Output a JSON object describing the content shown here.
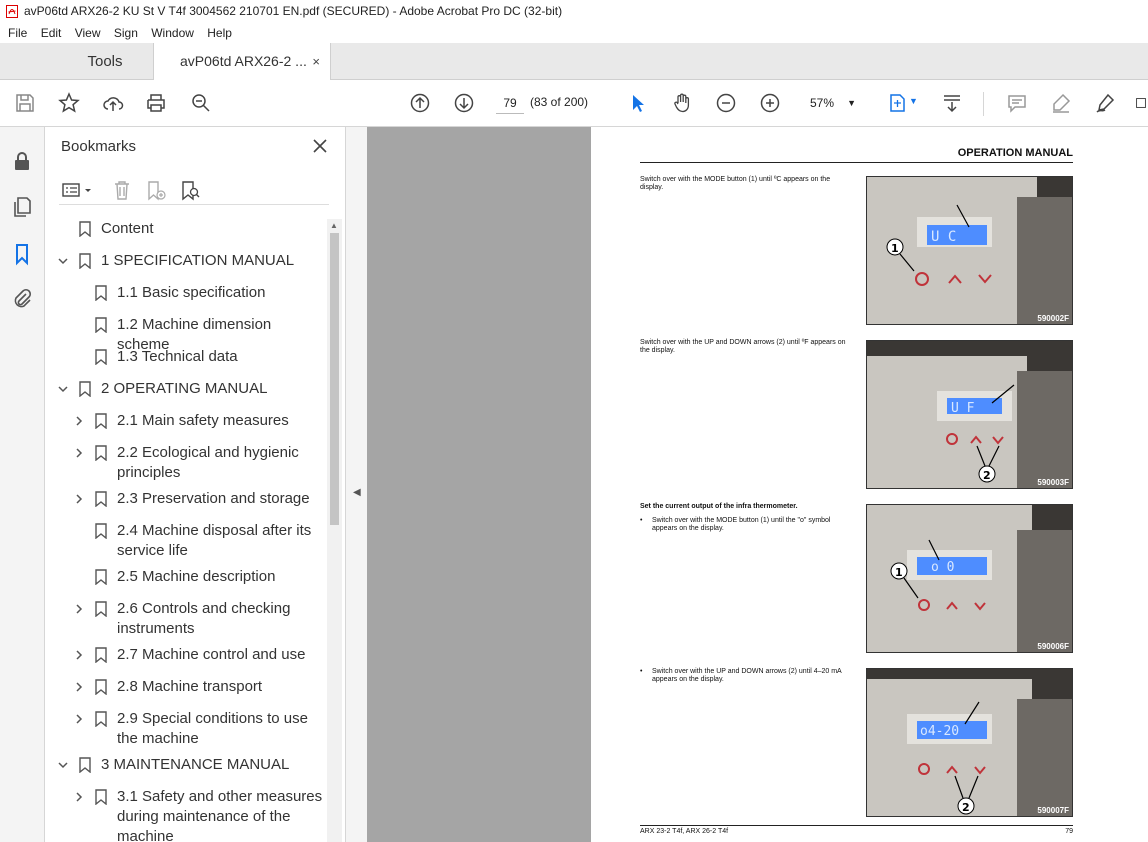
{
  "window": {
    "title": "avP06td ARX26-2 KU St V T4f 3004562 210701 EN.pdf (SECURED) - Adobe Acrobat Pro DC (32-bit)"
  },
  "menu": [
    "File",
    "Edit",
    "View",
    "Sign",
    "Window",
    "Help"
  ],
  "tabs": {
    "tools": "Tools",
    "document": "avP06td ARX26-2 ...",
    "close": "×"
  },
  "toolbar": {
    "page_value": "79",
    "page_count": "(83 of 200)",
    "zoom": "57%",
    "icons": [
      "save-icon",
      "star-icon",
      "upload-icon",
      "print-icon",
      "find-icon",
      "page-up-icon",
      "page-down-icon",
      "select-arrow-icon",
      "hand-icon",
      "zoom-out-icon",
      "zoom-in-icon",
      "fit-page-icon",
      "scroll-mode-icon",
      "comment-icon",
      "highlight-icon",
      "sign-icon"
    ]
  },
  "left_rail": {
    "icons": [
      "lock-icon",
      "pages-icon",
      "bookmark-icon",
      "attachment-icon"
    ]
  },
  "bookmarks": {
    "title": "Bookmarks",
    "items": [
      {
        "label": "Content",
        "level": 0,
        "expander": "none"
      },
      {
        "label": "1 SPECIFICATION MANUAL",
        "level": 0,
        "expander": "expanded"
      },
      {
        "label": "1.1 Basic specification",
        "level": 1,
        "expander": "none"
      },
      {
        "label": "1.2 Machine dimension scheme",
        "level": 1,
        "expander": "none"
      },
      {
        "label": "1.3 Technical data",
        "level": 1,
        "expander": "none"
      },
      {
        "label": "2 OPERATING MANUAL",
        "level": 0,
        "expander": "expanded"
      },
      {
        "label": "2.1 Main safety measures",
        "level": 1,
        "expander": "collapsed"
      },
      {
        "label": "2.2 Ecological and hygienic principles",
        "level": 1,
        "expander": "collapsed"
      },
      {
        "label": "2.3 Preservation and storage",
        "level": 1,
        "expander": "collapsed"
      },
      {
        "label": "2.4 Machine disposal after its service life",
        "level": 1,
        "expander": "none"
      },
      {
        "label": "2.5 Machine description",
        "level": 1,
        "expander": "none"
      },
      {
        "label": "2.6 Controls and checking instruments",
        "level": 1,
        "expander": "collapsed"
      },
      {
        "label": "2.7 Machine control and use",
        "level": 1,
        "expander": "collapsed"
      },
      {
        "label": "2.8 Machine transport",
        "level": 1,
        "expander": "collapsed"
      },
      {
        "label": "2.9 Special conditions to use the machine",
        "level": 1,
        "expander": "collapsed"
      },
      {
        "label": "3 MAINTENANCE MANUAL",
        "level": 0,
        "expander": "expanded"
      },
      {
        "label": "3.1 Safety and other measures during maintenance of the machine",
        "level": 1,
        "expander": "collapsed"
      }
    ]
  },
  "document_page": {
    "header": "OPERATION MANUAL",
    "blocks": [
      {
        "text": "Switch over with the MODE button (1) until ºC appears on the display.",
        "photo_code": "590002F",
        "callout": "1",
        "display": "U  C"
      },
      {
        "text": "Switch over with the UP and DOWN arrows (2) until ºF appears on the display.",
        "photo_code": "590003F",
        "callout": "2",
        "display": "U  F"
      },
      {
        "heading": "Set the current output of the infra thermometer.",
        "bullet": "•",
        "text": "Switch over with the MODE button (1) until the \"o\" symbol appears on the display.",
        "photo_code": "590006F",
        "callout": "1",
        "display": "o  0"
      },
      {
        "bullet": "•",
        "text": "Switch over with the UP and DOWN arrows (2) until 4–20 mA appears on the display.",
        "photo_code": "590007F",
        "callout": "2",
        "display": "o4-20"
      }
    ],
    "footer_left": "ARX 23-2 T4f, ARX 26-2 T4f",
    "footer_page": "79"
  }
}
